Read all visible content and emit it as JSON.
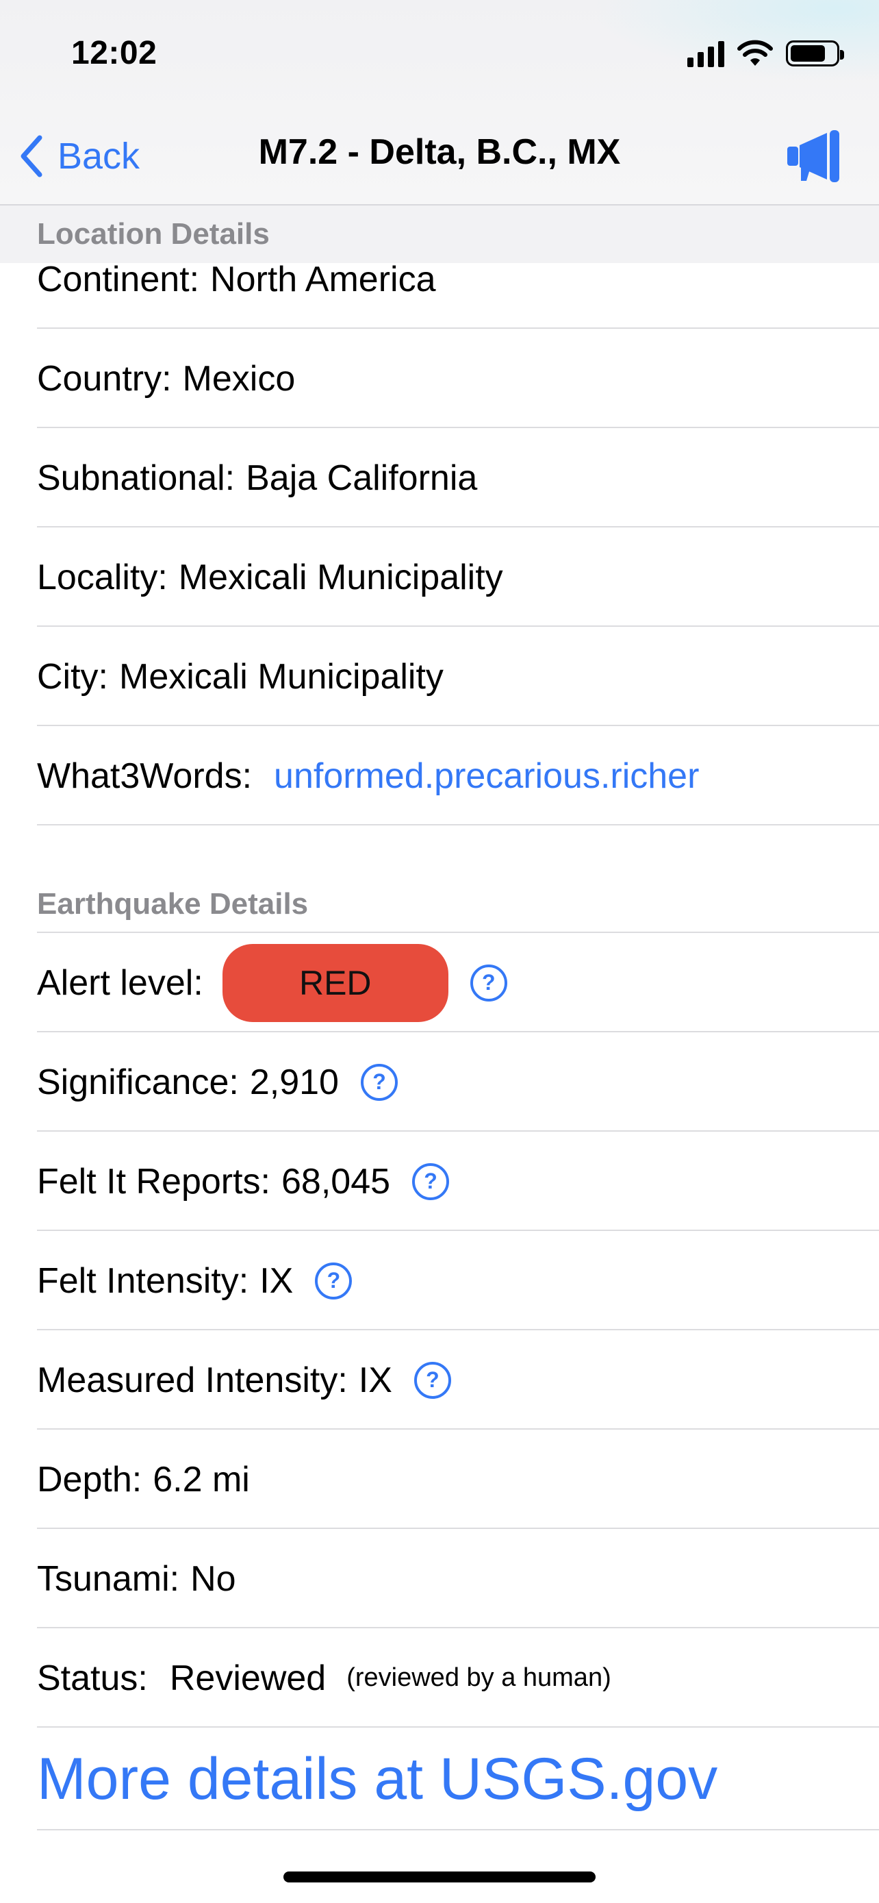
{
  "status_bar": {
    "time": "12:02"
  },
  "nav": {
    "back_label": "Back",
    "title": "M7.2 - Delta, B.C., MX",
    "action_icon": "megaphone-icon"
  },
  "location_section": {
    "header": "Location Details",
    "rows": [
      {
        "label": "Continent:",
        "value": "North America"
      },
      {
        "label": "Country:",
        "value": "Mexico"
      },
      {
        "label": "Subnational:",
        "value": "Baja California"
      },
      {
        "label": "Locality:",
        "value": "Mexicali Municipality"
      },
      {
        "label": "City:",
        "value": "Mexicali Municipality"
      },
      {
        "label": "What3Words:",
        "value": "unformed.precarious.richer"
      }
    ]
  },
  "earthquake_section": {
    "header": "Earthquake Details",
    "alert": {
      "label": "Alert level:",
      "value": "RED",
      "color": "#e74c3c"
    },
    "significance": {
      "label": "Significance:",
      "value": "2,910"
    },
    "felt_reports": {
      "label": "Felt It Reports:",
      "value": "68,045"
    },
    "felt_intensity": {
      "label": "Felt Intensity:",
      "value": "IX"
    },
    "measured_intensity": {
      "label": "Measured Intensity:",
      "value": "IX"
    },
    "depth": {
      "label": "Depth:",
      "value": "6.2 mi"
    },
    "tsunami": {
      "label": "Tsunami:",
      "value": "No"
    },
    "status": {
      "label": "Status:",
      "value": "Reviewed",
      "note": "(reviewed by a human)"
    },
    "more_link": "More details at USGS.gov",
    "help_glyph": "?"
  },
  "colors": {
    "accent": "#3478f6",
    "alert_red": "#e74c3c",
    "section_header": "#8a8a8e"
  }
}
